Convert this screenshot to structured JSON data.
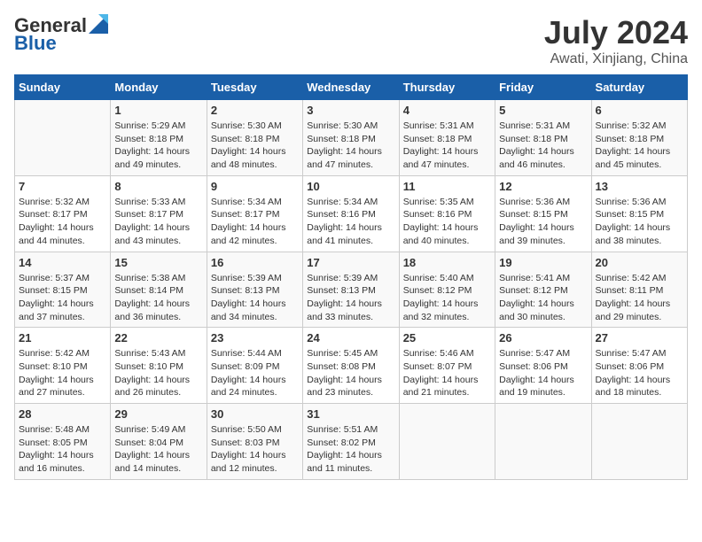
{
  "header": {
    "logo_general": "General",
    "logo_blue": "Blue",
    "month_year": "July 2024",
    "location": "Awati, Xinjiang, China"
  },
  "calendar": {
    "days_of_week": [
      "Sunday",
      "Monday",
      "Tuesday",
      "Wednesday",
      "Thursday",
      "Friday",
      "Saturday"
    ],
    "weeks": [
      [
        {
          "day": "",
          "info": ""
        },
        {
          "day": "1",
          "info": "Sunrise: 5:29 AM\nSunset: 8:18 PM\nDaylight: 14 hours\nand 49 minutes."
        },
        {
          "day": "2",
          "info": "Sunrise: 5:30 AM\nSunset: 8:18 PM\nDaylight: 14 hours\nand 48 minutes."
        },
        {
          "day": "3",
          "info": "Sunrise: 5:30 AM\nSunset: 8:18 PM\nDaylight: 14 hours\nand 47 minutes."
        },
        {
          "day": "4",
          "info": "Sunrise: 5:31 AM\nSunset: 8:18 PM\nDaylight: 14 hours\nand 47 minutes."
        },
        {
          "day": "5",
          "info": "Sunrise: 5:31 AM\nSunset: 8:18 PM\nDaylight: 14 hours\nand 46 minutes."
        },
        {
          "day": "6",
          "info": "Sunrise: 5:32 AM\nSunset: 8:18 PM\nDaylight: 14 hours\nand 45 minutes."
        }
      ],
      [
        {
          "day": "7",
          "info": "Sunrise: 5:32 AM\nSunset: 8:17 PM\nDaylight: 14 hours\nand 44 minutes."
        },
        {
          "day": "8",
          "info": "Sunrise: 5:33 AM\nSunset: 8:17 PM\nDaylight: 14 hours\nand 43 minutes."
        },
        {
          "day": "9",
          "info": "Sunrise: 5:34 AM\nSunset: 8:17 PM\nDaylight: 14 hours\nand 42 minutes."
        },
        {
          "day": "10",
          "info": "Sunrise: 5:34 AM\nSunset: 8:16 PM\nDaylight: 14 hours\nand 41 minutes."
        },
        {
          "day": "11",
          "info": "Sunrise: 5:35 AM\nSunset: 8:16 PM\nDaylight: 14 hours\nand 40 minutes."
        },
        {
          "day": "12",
          "info": "Sunrise: 5:36 AM\nSunset: 8:15 PM\nDaylight: 14 hours\nand 39 minutes."
        },
        {
          "day": "13",
          "info": "Sunrise: 5:36 AM\nSunset: 8:15 PM\nDaylight: 14 hours\nand 38 minutes."
        }
      ],
      [
        {
          "day": "14",
          "info": "Sunrise: 5:37 AM\nSunset: 8:15 PM\nDaylight: 14 hours\nand 37 minutes."
        },
        {
          "day": "15",
          "info": "Sunrise: 5:38 AM\nSunset: 8:14 PM\nDaylight: 14 hours\nand 36 minutes."
        },
        {
          "day": "16",
          "info": "Sunrise: 5:39 AM\nSunset: 8:13 PM\nDaylight: 14 hours\nand 34 minutes."
        },
        {
          "day": "17",
          "info": "Sunrise: 5:39 AM\nSunset: 8:13 PM\nDaylight: 14 hours\nand 33 minutes."
        },
        {
          "day": "18",
          "info": "Sunrise: 5:40 AM\nSunset: 8:12 PM\nDaylight: 14 hours\nand 32 minutes."
        },
        {
          "day": "19",
          "info": "Sunrise: 5:41 AM\nSunset: 8:12 PM\nDaylight: 14 hours\nand 30 minutes."
        },
        {
          "day": "20",
          "info": "Sunrise: 5:42 AM\nSunset: 8:11 PM\nDaylight: 14 hours\nand 29 minutes."
        }
      ],
      [
        {
          "day": "21",
          "info": "Sunrise: 5:42 AM\nSunset: 8:10 PM\nDaylight: 14 hours\nand 27 minutes."
        },
        {
          "day": "22",
          "info": "Sunrise: 5:43 AM\nSunset: 8:10 PM\nDaylight: 14 hours\nand 26 minutes."
        },
        {
          "day": "23",
          "info": "Sunrise: 5:44 AM\nSunset: 8:09 PM\nDaylight: 14 hours\nand 24 minutes."
        },
        {
          "day": "24",
          "info": "Sunrise: 5:45 AM\nSunset: 8:08 PM\nDaylight: 14 hours\nand 23 minutes."
        },
        {
          "day": "25",
          "info": "Sunrise: 5:46 AM\nSunset: 8:07 PM\nDaylight: 14 hours\nand 21 minutes."
        },
        {
          "day": "26",
          "info": "Sunrise: 5:47 AM\nSunset: 8:06 PM\nDaylight: 14 hours\nand 19 minutes."
        },
        {
          "day": "27",
          "info": "Sunrise: 5:47 AM\nSunset: 8:06 PM\nDaylight: 14 hours\nand 18 minutes."
        }
      ],
      [
        {
          "day": "28",
          "info": "Sunrise: 5:48 AM\nSunset: 8:05 PM\nDaylight: 14 hours\nand 16 minutes."
        },
        {
          "day": "29",
          "info": "Sunrise: 5:49 AM\nSunset: 8:04 PM\nDaylight: 14 hours\nand 14 minutes."
        },
        {
          "day": "30",
          "info": "Sunrise: 5:50 AM\nSunset: 8:03 PM\nDaylight: 14 hours\nand 12 minutes."
        },
        {
          "day": "31",
          "info": "Sunrise: 5:51 AM\nSunset: 8:02 PM\nDaylight: 14 hours\nand 11 minutes."
        },
        {
          "day": "",
          "info": ""
        },
        {
          "day": "",
          "info": ""
        },
        {
          "day": "",
          "info": ""
        }
      ]
    ]
  }
}
